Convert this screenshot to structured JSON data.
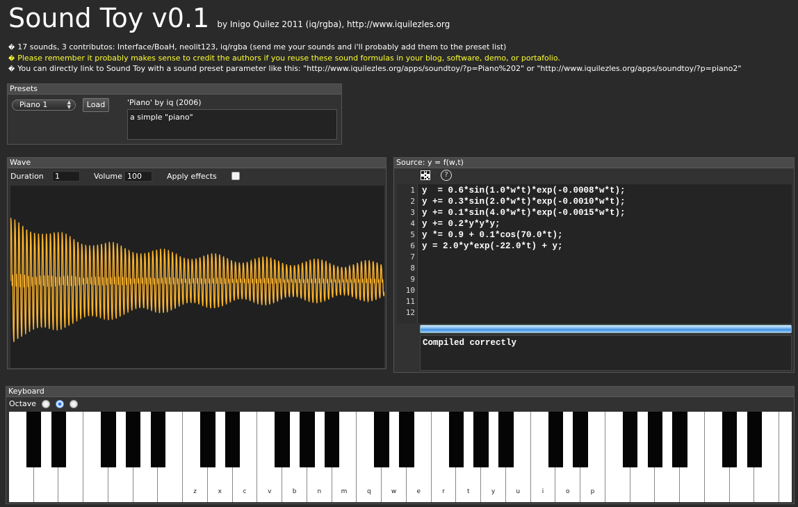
{
  "header": {
    "title": "Sound Toy v0.1",
    "byline": "by Inigo Quilez 2011 (iq/rgba), http://www.iquilezles.org",
    "bullet": "�",
    "info_lines": [
      "17 sounds, 3 contributos: Interface/BoaH, neolit123, iq/rgba (send me your sounds and i'll probably add them to the preset list)",
      "Please remember it probably makes sense to credit the authors if you reuse these sound formulas in your blog, software, demo, or portafolio.",
      "You can directly link to Sound Toy with a sound preset parameter like this: \"http://www.iquilezles.org/apps/soundtoy/?p=Piano%202\" or \"http://www.iquilezles.org/apps/soundtoy/?p=piano2\""
    ]
  },
  "presets": {
    "label": "Presets",
    "selected": "Piano 1",
    "load_label": "Load",
    "name": "'Piano' by iq (2006)",
    "description": "a simple \"piano\""
  },
  "wave": {
    "label": "Wave",
    "duration_label": "Duration",
    "duration_value": "1",
    "volume_label": "Volume",
    "volume_value": "100",
    "apply_effects_label": "Apply effects",
    "apply_effects_checked": false,
    "color": "#ffb52e"
  },
  "source": {
    "label": "Source: y = f(w,t)",
    "help_icon_glyph": "?",
    "line_numbers": [
      "1",
      "2",
      "3",
      "4",
      "5",
      "6",
      "7",
      "8",
      "9",
      "10",
      "11",
      "12"
    ],
    "code": [
      "y  = 0.6*sin(1.0*w*t)*exp(-0.0008*w*t);",
      "y += 0.3*sin(2.0*w*t)*exp(-0.0010*w*t);",
      "y += 0.1*sin(4.0*w*t)*exp(-0.0015*w*t);",
      "y += 0.2*y*y*y;",
      "y *= 0.9 + 0.1*cos(70.0*t);",
      "y = 2.0*y*exp(-22.0*t) + y;"
    ],
    "status": "Compiled correctly"
  },
  "keyboard": {
    "label": "Keyboard",
    "octave_label": "Octave",
    "octave_selected": 1,
    "octave_count": 3,
    "white_key_count": 32,
    "key_labels": [
      {
        "index": 7,
        "label": "z"
      },
      {
        "index": 8,
        "label": "x"
      },
      {
        "index": 9,
        "label": "c"
      },
      {
        "index": 10,
        "label": "v"
      },
      {
        "index": 11,
        "label": "b"
      },
      {
        "index": 12,
        "label": "n"
      },
      {
        "index": 13,
        "label": "m"
      },
      {
        "index": 14,
        "label": "q"
      },
      {
        "index": 15,
        "label": "w"
      },
      {
        "index": 16,
        "label": "e"
      },
      {
        "index": 17,
        "label": "r"
      },
      {
        "index": 18,
        "label": "t"
      },
      {
        "index": 19,
        "label": "y"
      },
      {
        "index": 20,
        "label": "u"
      },
      {
        "index": 21,
        "label": "i"
      },
      {
        "index": 22,
        "label": "o"
      },
      {
        "index": 23,
        "label": "p"
      }
    ]
  }
}
